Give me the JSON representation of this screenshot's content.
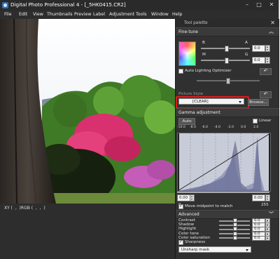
{
  "window": {
    "title": "Digital Photo Professional 4 - [_5HK0415.CR2]",
    "controls": [
      "–",
      "□",
      "✕"
    ]
  },
  "menu": [
    "File",
    "Edit",
    "View",
    "Thumbnails",
    "Preview",
    "Label",
    "Adjustment",
    "Tools",
    "Window",
    "Help"
  ],
  "status": {
    "readout": "XY (  ,  )RGB (  ,  ,  )"
  },
  "palette": {
    "title": "Tool palette",
    "fine_tune": {
      "header": "Fine-tune",
      "labels": {
        "b": "B",
        "a": "A",
        "m": "M",
        "g": "G"
      },
      "values": {
        "ba": "0.0",
        "mg": "0.0"
      },
      "auto_lighting": "Auto Lighting Optimizer",
      "auto_lighting_checked": false
    },
    "picture_style": {
      "header": "Picture Style",
      "selected": "[CLEAR]",
      "browse": "Browse..."
    },
    "gamma": {
      "header": "Gamma adjustment",
      "auto": "Auto",
      "linear": "Linear",
      "scale": [
        "-10.0",
        "-8.0",
        "-6.0",
        "-4.0",
        "-2.0",
        "0.0",
        "2.0"
      ],
      "left_value": "0.00",
      "right_value": "0.00",
      "row_values": [
        "0",
        "255"
      ],
      "move_midpoint": "Move midpoint to match",
      "move_midpoint_checked": true
    },
    "advanced": {
      "header": "Advanced",
      "rows": [
        {
          "label": "Contrast",
          "value": "0.0",
          "level": 0.5
        },
        {
          "label": "Shadow",
          "value": "0.0",
          "level": 0.5
        },
        {
          "label": "Highlight",
          "value": "0.0",
          "level": 0.5
        },
        {
          "label": "Color tone",
          "value": "0.0",
          "level": 0.5
        },
        {
          "label": "Color saturation",
          "value": "0.0",
          "level": 0.5
        }
      ]
    },
    "sharpness": {
      "header": "Sharpness",
      "checked": true,
      "mode": "Unsharp mask"
    }
  },
  "colors": {
    "highlight_border": "#e01b1b",
    "panel_bg": "#303030"
  }
}
